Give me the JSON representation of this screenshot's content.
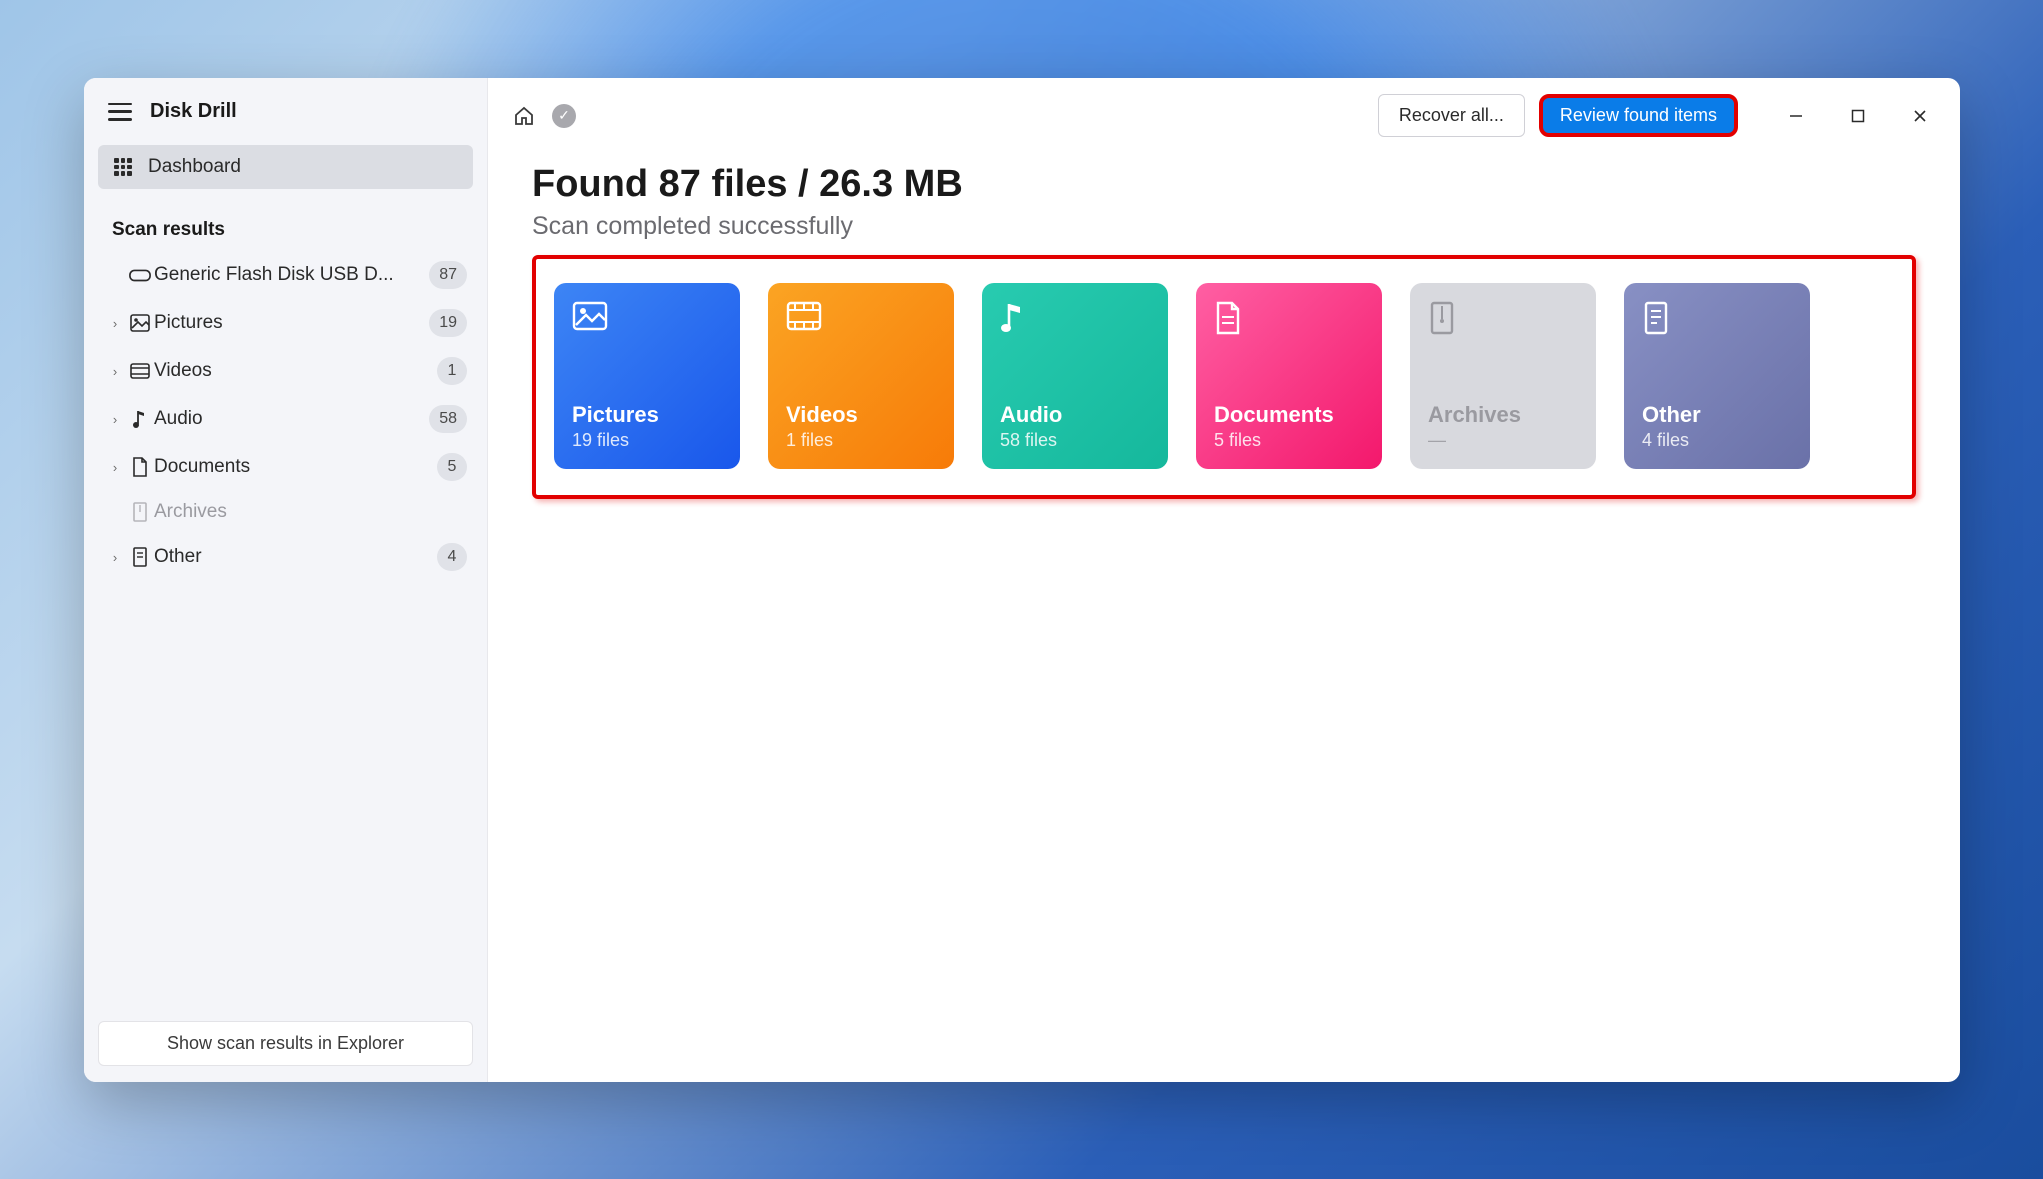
{
  "app": {
    "title": "Disk Drill"
  },
  "sidebar": {
    "dashboard_label": "Dashboard",
    "section_title": "Scan results",
    "footer_label": "Show scan results in Explorer",
    "device": {
      "label": "Generic Flash Disk USB D...",
      "count": "87"
    },
    "items": [
      {
        "label": "Pictures",
        "count": "19"
      },
      {
        "label": "Videos",
        "count": "1"
      },
      {
        "label": "Audio",
        "count": "58"
      },
      {
        "label": "Documents",
        "count": "5"
      },
      {
        "label": "Archives",
        "count": ""
      },
      {
        "label": "Other",
        "count": "4"
      }
    ]
  },
  "toolbar": {
    "recover_label": "Recover all...",
    "review_label": "Review found items"
  },
  "results": {
    "headline": "Found 87 files / 26.3 MB",
    "subhead": "Scan completed successfully",
    "cards": [
      {
        "title": "Pictures",
        "sub": "19 files"
      },
      {
        "title": "Videos",
        "sub": "1 files"
      },
      {
        "title": "Audio",
        "sub": "58 files"
      },
      {
        "title": "Documents",
        "sub": "5 files"
      },
      {
        "title": "Archives",
        "sub": "—"
      },
      {
        "title": "Other",
        "sub": "4 files"
      }
    ]
  }
}
